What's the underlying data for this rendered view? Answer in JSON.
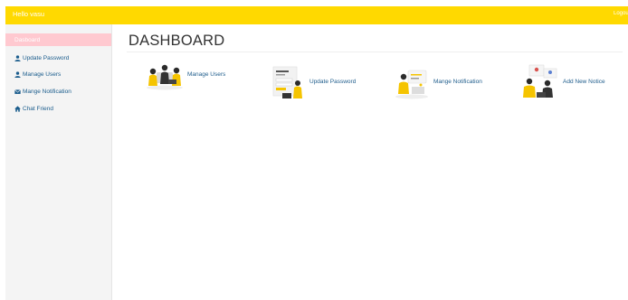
{
  "header": {
    "greeting": "Hello vasu",
    "logout_label": "Logout",
    "bar_color": "#ffd900"
  },
  "sidebar": {
    "items": [
      {
        "label": "Dasboard",
        "icon": "none",
        "active": true
      },
      {
        "label": "Update Password",
        "icon": "user-icon",
        "active": false
      },
      {
        "label": "Manage Users",
        "icon": "user-icon",
        "active": false
      },
      {
        "label": "Mange Notification",
        "icon": "envelope-icon",
        "active": false
      },
      {
        "label": "Chat Friend",
        "icon": "home-icon",
        "active": false
      }
    ]
  },
  "main": {
    "title": "DASHBOARD",
    "cards": [
      {
        "label": "Manage Users",
        "illustration": "team-illustration"
      },
      {
        "label": "Update Password",
        "illustration": "password-illustration"
      },
      {
        "label": "Mange Notification",
        "illustration": "notification-illustration"
      },
      {
        "label": "Add New Notice",
        "illustration": "notice-illustration"
      }
    ]
  },
  "colors": {
    "accent": "#ffd900",
    "active_item": "#ffc9d0",
    "link": "#1f5d8c"
  }
}
